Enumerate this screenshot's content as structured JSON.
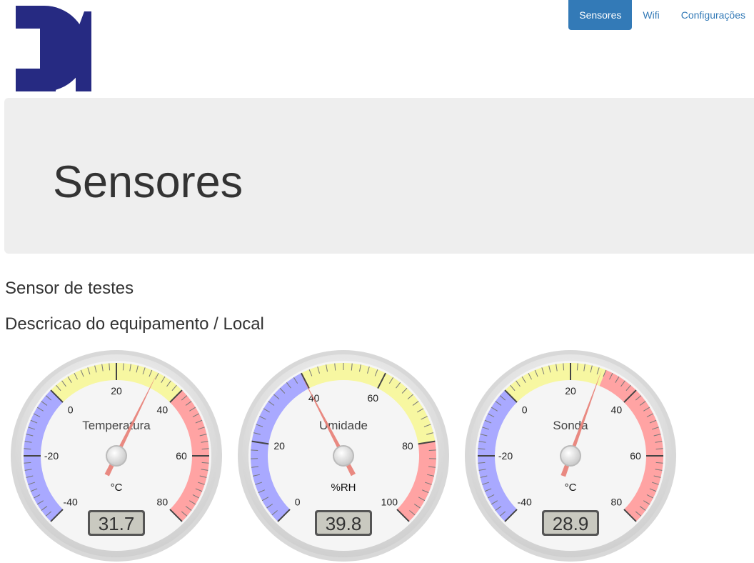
{
  "nav": {
    "items": [
      {
        "label": "Sensores",
        "active": true
      },
      {
        "label": "Wifi",
        "active": false
      },
      {
        "label": "Configurações",
        "active": false
      }
    ]
  },
  "jumbotron": {
    "title": "Sensores"
  },
  "sensor": {
    "name": "Sensor de testes",
    "description": "Descricao do equipamento / Local"
  },
  "colors": {
    "nav_active": "#337ab7",
    "link": "#337ab7",
    "logo": "#262a82",
    "zone_cold": "#a9a9ff",
    "zone_mid": "#f7f7a1",
    "zone_hot": "#ffa3a3",
    "needle": "#e8837a"
  },
  "gauges": [
    {
      "id": "temperature",
      "title": "Temperatura",
      "units": "°C",
      "min": -40,
      "max": 80,
      "value": 31.7,
      "value_text": "31.7",
      "major_ticks": [
        "-40",
        "-20",
        "0",
        "20",
        "40",
        "60",
        "80"
      ],
      "minor_ticks": 10,
      "highlights": [
        {
          "from": -40,
          "to": 0,
          "color": "#a9a9ff"
        },
        {
          "from": 0,
          "to": 40,
          "color": "#f7f7a1"
        },
        {
          "from": 40,
          "to": 80,
          "color": "#ffa3a3"
        }
      ]
    },
    {
      "id": "humidity",
      "title": "Umidade",
      "units": "%RH",
      "min": 0,
      "max": 100,
      "value": 39.8,
      "value_text": "39.8",
      "major_ticks": [
        "0",
        "20",
        "40",
        "60",
        "80",
        "100"
      ],
      "minor_ticks": 10,
      "highlights": [
        {
          "from": 0,
          "to": 40,
          "color": "#a9a9ff"
        },
        {
          "from": 40,
          "to": 80,
          "color": "#f7f7a1"
        },
        {
          "from": 80,
          "to": 100,
          "color": "#ffa3a3"
        }
      ]
    },
    {
      "id": "probe",
      "title": "Sonda",
      "units": "°C",
      "min": -40,
      "max": 80,
      "value": 28.9,
      "value_text": "28.9",
      "major_ticks": [
        "-40",
        "-20",
        "0",
        "20",
        "40",
        "60",
        "80"
      ],
      "minor_ticks": 10,
      "highlights": [
        {
          "from": -40,
          "to": 0,
          "color": "#a9a9ff"
        },
        {
          "from": 0,
          "to": 30,
          "color": "#f7f7a1"
        },
        {
          "from": 30,
          "to": 80,
          "color": "#ffa3a3"
        }
      ]
    }
  ]
}
